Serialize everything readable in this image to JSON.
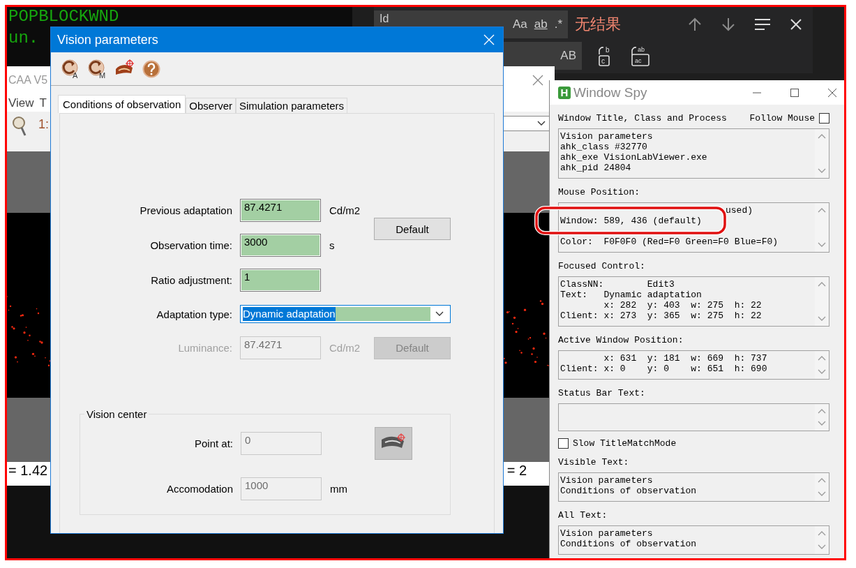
{
  "terminal": {
    "lines": [
      "POPBLOCKWND",
      "un."
    ]
  },
  "find_bar": {
    "search_value": "Id",
    "toggles": [
      "Aa",
      "ab",
      ".*"
    ],
    "result": "无结果",
    "replace_toggle": "AB",
    "replace_buttons": [
      {
        "kind": "replace",
        "top": "b",
        "bottom": "c"
      },
      {
        "kind": "replace_all",
        "top": "ab",
        "bottom": "ac"
      }
    ]
  },
  "background_window": {
    "title": "CAA V5",
    "menu": [
      "View",
      "T"
    ],
    "toolbar_label": "1:",
    "status_left": "= 1.42",
    "status_right": "= 2"
  },
  "dialog": {
    "title": "Vision parameters",
    "toolbar": [
      {
        "kind": "reset",
        "badge": "A"
      },
      {
        "kind": "reset",
        "badge": "M"
      },
      {
        "kind": "eye"
      },
      {
        "kind": "help"
      }
    ],
    "tabs": [
      {
        "label": "Conditions of observation",
        "selected": true
      },
      {
        "label": "Observer",
        "selected": false
      },
      {
        "label": "Simulation parameters",
        "selected": false
      }
    ],
    "rows": [
      {
        "kind": "field",
        "label": "Previous adaptation",
        "value": "87.4271",
        "unit": "Cd/m2",
        "disabled": false
      },
      {
        "kind": "field",
        "label": "Observation time:",
        "value": "3000",
        "unit": "s",
        "disabled": false
      },
      {
        "kind": "field",
        "label": "Ratio adjustment:",
        "value": "1",
        "disabled": false
      },
      {
        "kind": "dropdown",
        "label": "Adaptation type:",
        "value": "Dynamic adaptation",
        "disabled": false
      },
      {
        "kind": "field",
        "label": "Luminance:",
        "value": "87.4271",
        "unit": "Cd/m2",
        "disabled": true
      }
    ],
    "default_buttons": [
      {
        "label": "Default",
        "disabled": false
      },
      {
        "label": "Default",
        "disabled": true
      }
    ],
    "group": {
      "title": "Vision center",
      "rows": [
        {
          "label": "Point at:",
          "value": "0",
          "disabled": true
        },
        {
          "label": "Accomodation",
          "value": "1000",
          "unit": "mm",
          "disabled": true
        }
      ]
    }
  },
  "window_spy": {
    "title": "Window Spy",
    "icon_letter": "H",
    "follow_mouse": {
      "label": "Follow Mouse",
      "checked": false
    },
    "sections": [
      {
        "kind": "box",
        "heading": "Window Title, Class and Process",
        "lines": [
          "Vision parameters",
          "ahk_class #32770",
          "ahk_exe VisionLabViewer.exe",
          "ahk_pid 24804"
        ]
      },
      {
        "kind": "box",
        "heading": "Mouse Position:",
        "partial_line": "used)",
        "lines": [
          "Window: 589, 436 (default)",
          "Color:  F0F0F0 (Red=F0 Green=F0 Blue=F0)"
        ]
      },
      {
        "kind": "box",
        "heading": "Focused Control:",
        "lines": [
          "ClassNN:        Edit3",
          "Text:   Dynamic adaptation",
          "        x: 282  y: 403  w: 275  h: 22",
          "Client: x: 273  y: 365  w: 275  h: 22"
        ]
      },
      {
        "kind": "box",
        "heading": "Active Window Position:",
        "lines": [
          "        x: 631  y: 181  w: 669  h: 737",
          "Client: x: 0    y: 0    w: 651  h: 690"
        ]
      },
      {
        "kind": "box",
        "heading": "Status Bar Text:"
      },
      {
        "kind": "checkbox",
        "label": "Slow TitleMatchMode",
        "checked": false
      },
      {
        "kind": "box",
        "heading": "Visible Text:",
        "lines": [
          "Vision parameters",
          "Conditions of observation"
        ]
      },
      {
        "kind": "box",
        "heading": "All Text:",
        "lines": [
          "Vision parameters",
          "Conditions of observation"
        ]
      }
    ]
  }
}
